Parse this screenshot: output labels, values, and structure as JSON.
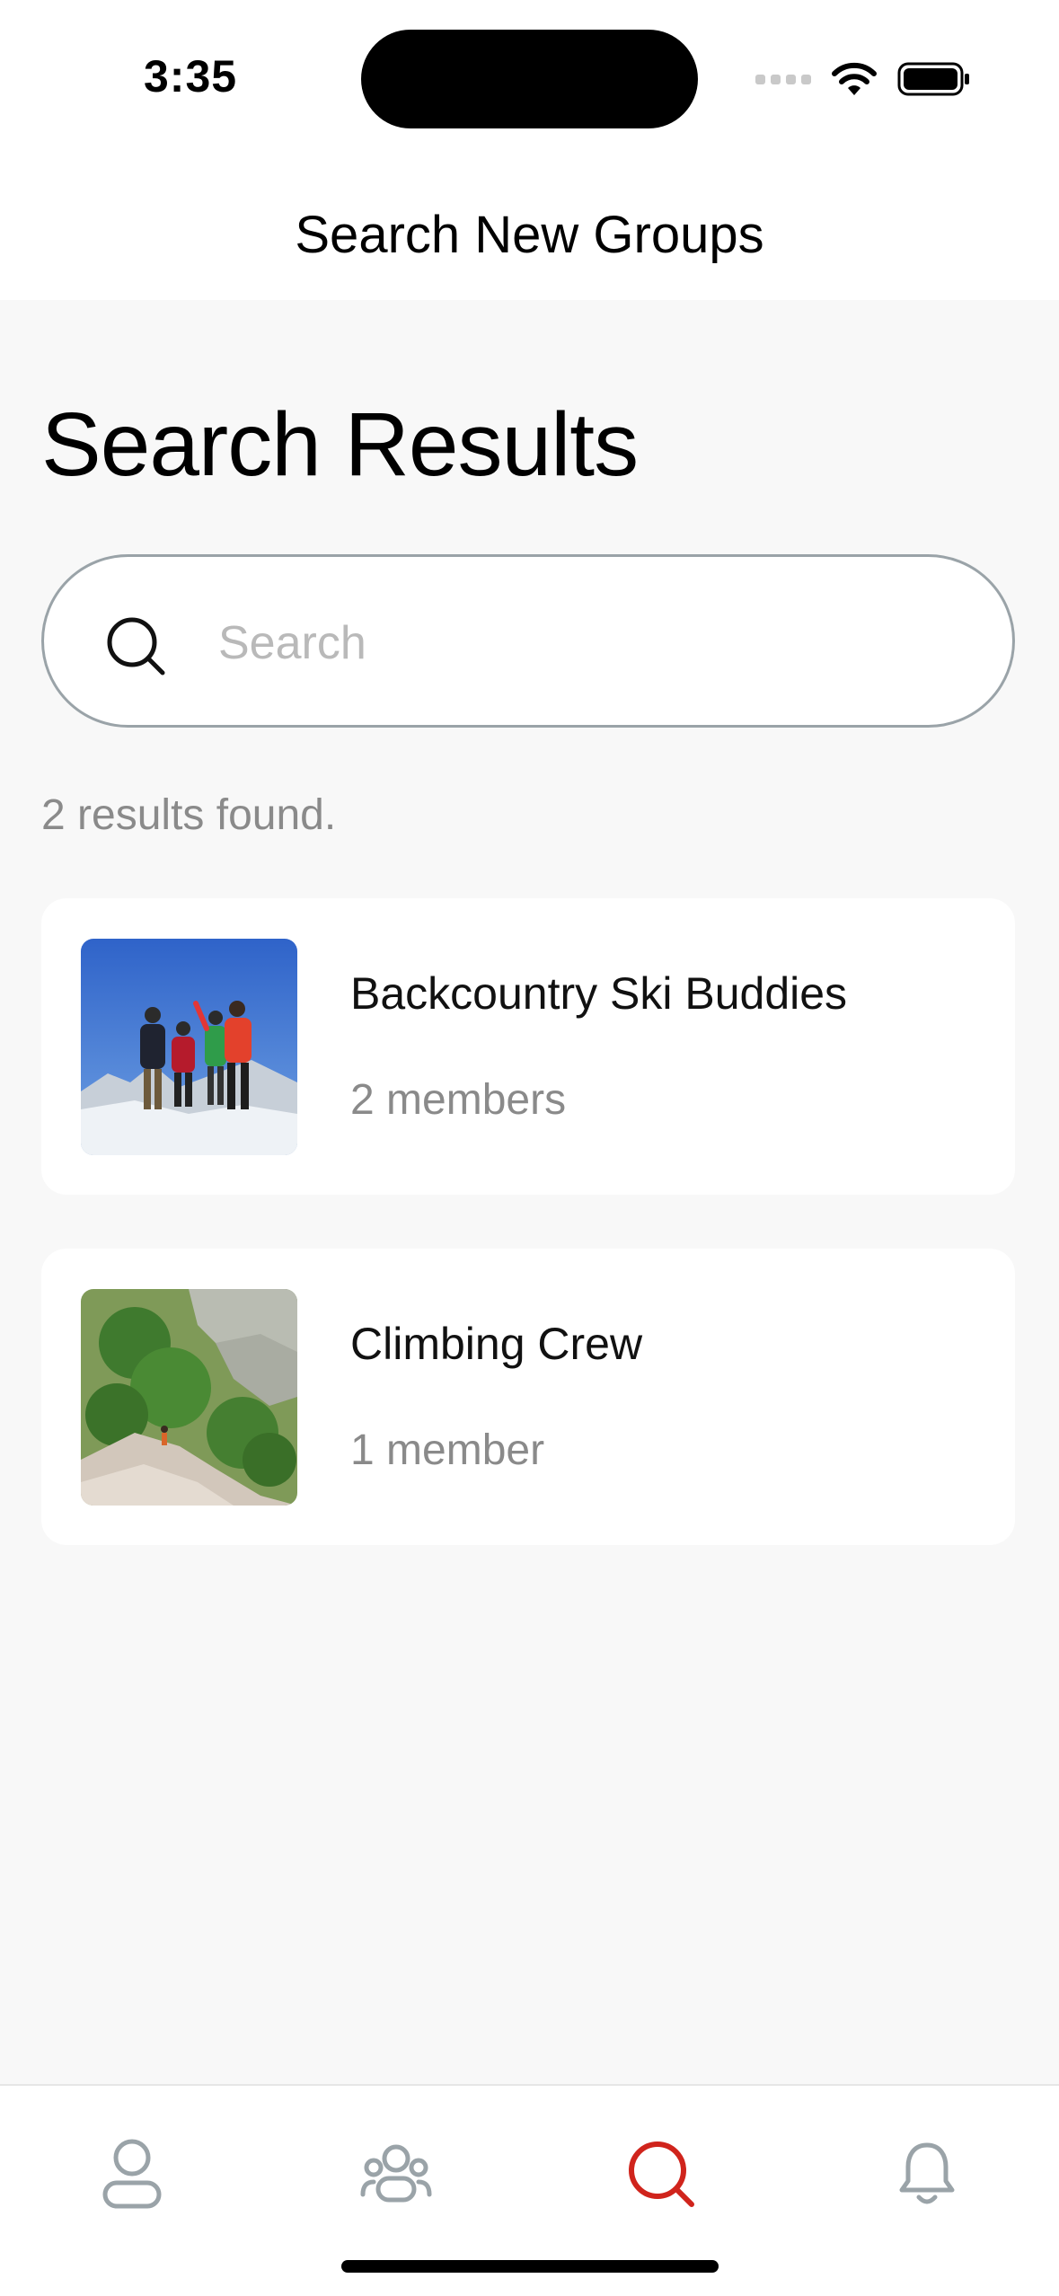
{
  "status_bar": {
    "time": "3:35"
  },
  "header": {
    "title": "Search New Groups"
  },
  "main": {
    "heading": "Search Results",
    "search": {
      "placeholder": "Search",
      "value": ""
    },
    "result_count": "2 results found.",
    "groups": [
      {
        "name": "Backcountry Ski Buddies",
        "members": "2 members",
        "image": "group-photo-skiers"
      },
      {
        "name": "Climbing Crew",
        "members": "1 member",
        "image": "group-photo-climbing"
      }
    ]
  },
  "tab_bar": {
    "items": [
      {
        "icon": "profile-icon",
        "active": false
      },
      {
        "icon": "groups-icon",
        "active": false
      },
      {
        "icon": "search-icon",
        "active": true
      },
      {
        "icon": "bell-icon",
        "active": false
      }
    ],
    "active_color": "#d0241c",
    "inactive_color": "#9aa3a8"
  }
}
